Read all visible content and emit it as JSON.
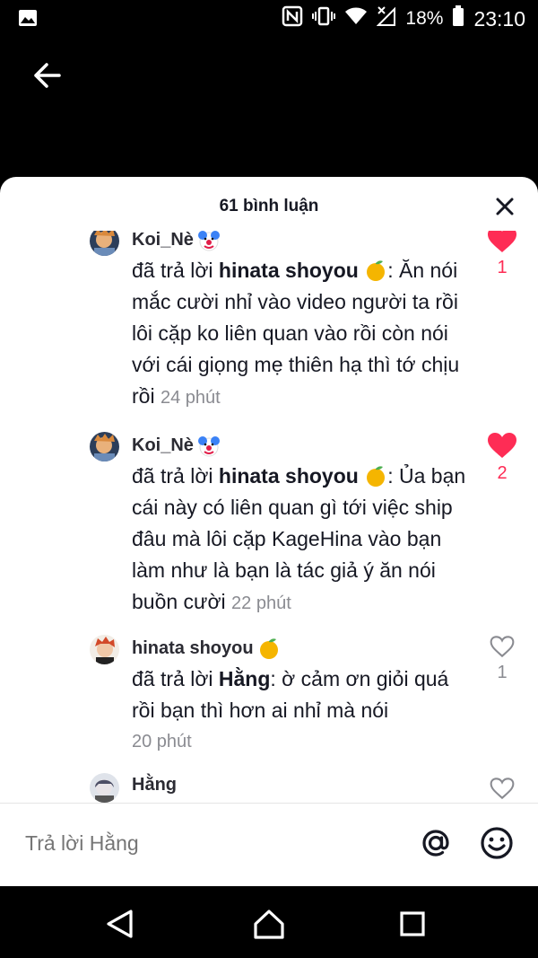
{
  "status_bar": {
    "battery": "18%",
    "time": "23:10"
  },
  "sheet": {
    "title": "61 bình luận"
  },
  "comments": [
    {
      "username": "Koi_Nè",
      "reply_prefix": "đã trả lời ",
      "reply_to": "hinata shoyou",
      "text": ": Ăn nói mắc cười nhỉ vào video người ta rồi lôi cặp ko liên quan vào rồi còn nói với cái giọng mẹ thiên hạ thì tớ chịu rồi",
      "time": "24 phút",
      "likes": "1",
      "liked": true
    },
    {
      "username": "Koi_Nè",
      "reply_prefix": "đã trả lời ",
      "reply_to": "hinata shoyou",
      "text": ": Ủa bạn cái này có liên quan gì tới việc ship đâu mà lôi cặp KageHina vào bạn làm như là bạn là tác giả ý ăn nói buồn cười",
      "time": "22 phút",
      "likes": "2",
      "liked": true
    },
    {
      "username": "hinata shoyou",
      "reply_prefix": "đã trả lời ",
      "reply_to": "Hằng",
      "text": ": ờ cảm ơn giỏi quá rồi bạn thì hơn ai nhỉ mà nói",
      "time": "20 phút",
      "likes": "1",
      "liked": false
    },
    {
      "username": "Hằng",
      "liked": false
    }
  ],
  "reply_bar": {
    "placeholder": "Trả lời Hằng"
  },
  "icons": {
    "heart_filled": "#fe2c55",
    "heart_outline": "#8a8b91"
  }
}
